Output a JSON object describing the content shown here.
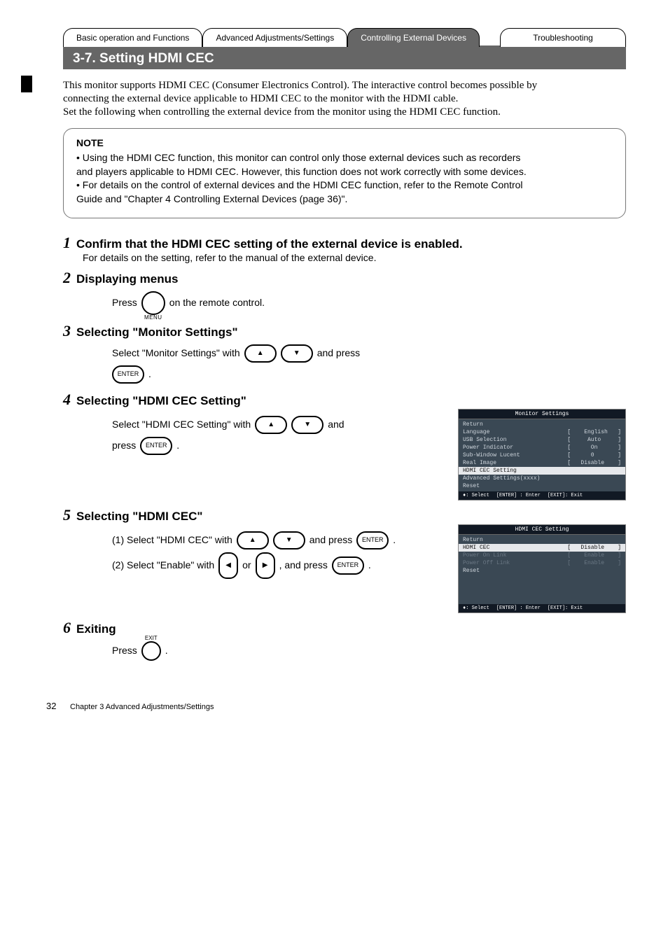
{
  "tabs": {
    "t1": "Basic operation and\nFunctions",
    "t2": "Advanced\nAdjustments/Settings",
    "t3": "Controlling External\nDevices",
    "t4": "Troubleshooting"
  },
  "header_section": "3-7. Setting HDMI CEC",
  "intro": {
    "l1": "This monitor supports HDMI CEC (Consumer Electronics Control). The interactive control becomes possible by",
    "l2": "connecting the external device applicable to HDMI CEC to the monitor with the HDMI cable.",
    "l3": "Set the following when controlling the external device from the monitor using the HDMI CEC function."
  },
  "note": {
    "title": "NOTE",
    "b1": "• Using the HDMI CEC function, this monitor can control only those external devices such as recorders",
    "b2": "  and players applicable to HDMI CEC. However, this function does not work correctly with some devices.",
    "b3": "• For details on the control of external devices and the HDMI CEC function, refer to the Remote Control",
    "b4": "  Guide and \"Chapter 4 Controlling External Devices (page 36)\"."
  },
  "step1": {
    "num": "1",
    "title": "Confirm that the HDMI CEC setting of the external device is enabled.",
    "sub": "For details on the setting, refer to the manual of the external device."
  },
  "step2": {
    "num": "2",
    "title": "Displaying menus",
    "body_a": "Press ",
    "body_b": " on the remote control.",
    "menu_cap": "MENU"
  },
  "step3": {
    "num": "3",
    "title": "Selecting \"Monitor Settings\"",
    "a1": "Select \"Monitor Settings\" with ",
    "a2": " and press",
    "b1": "."
  },
  "step4": {
    "num": "4",
    "title": "Selecting \"HDMI CEC Setting\"",
    "a1": "Select \"HDMI CEC Setting\" with ",
    "a2": " and",
    "b1": "press ",
    "b2": "."
  },
  "step5": {
    "num": "5",
    "title": "Selecting \"HDMI CEC\"",
    "a1": "(1) Select \"HDMI CEC\" with ",
    "a2": " and press ",
    "a3": ".",
    "b1": "(2) Select \"Enable\" with ",
    "b2": " or ",
    "b3": ", and press ",
    "b4": "."
  },
  "step6": {
    "num": "6",
    "title": "Exiting",
    "a1": "Press ",
    "a2": ".",
    "exit_cap": "EXIT"
  },
  "btn": {
    "enter": "ENTER"
  },
  "osd1": {
    "title": "Monitor Settings",
    "rows": {
      "r0": "Return",
      "r1": {
        "lbl": "Language",
        "val": "[    English   ]"
      },
      "r2": {
        "lbl": "USB Selection",
        "val": "[     Auto     ]"
      },
      "r3": {
        "lbl": "Power Indicator",
        "val": "[      On      ]"
      },
      "r4": {
        "lbl": "Sub-Window Lucent",
        "val": "[      0       ]"
      },
      "r5": {
        "lbl": "Real Image",
        "val": "[   Disable    ]"
      },
      "r6": "HDMI CEC Setting",
      "r7": "Advanced Settings(xxxx)",
      "r8": "Reset"
    },
    "foot": {
      "f1": "♦: Select",
      "f2": "[ENTER] : Enter",
      "f3": "[EXIT]: Exit"
    }
  },
  "osd2": {
    "title": "HDMI CEC Setting",
    "rows": {
      "r0": "Return",
      "r1": {
        "lbl": "HDMI CEC",
        "val": "[   Disable    ]"
      },
      "r2": {
        "lbl": "Power On Link",
        "val": "[    Enable    ]"
      },
      "r3": {
        "lbl": "Power Off Link",
        "val": "[    Enable    ]"
      },
      "r4": "Reset"
    },
    "foot": {
      "f1": "♦: Select",
      "f2": "[ENTER] : Enter",
      "f3": "[EXIT]: Exit"
    }
  },
  "footer": {
    "page": "32",
    "chap": "Chapter 3  Advanced Adjustments/Settings"
  }
}
